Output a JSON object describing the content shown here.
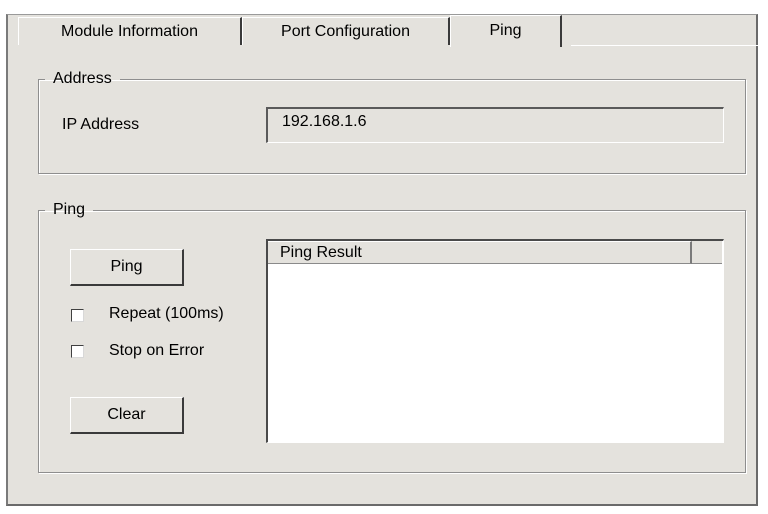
{
  "tabs": [
    {
      "label": "Module Information",
      "active": false
    },
    {
      "label": "Port Configuration",
      "active": false
    },
    {
      "label": "Ping",
      "active": true
    }
  ],
  "address_group": {
    "legend": "Address",
    "ip_label": "IP Address",
    "ip_value": "192.168.1.6"
  },
  "ping_group": {
    "legend": "Ping",
    "ping_button": "Ping",
    "repeat_label": "Repeat (100ms)",
    "repeat_checked": false,
    "stop_label": "Stop on Error",
    "stop_checked": false,
    "clear_button": "Clear",
    "result_header": "Ping Result",
    "results": []
  }
}
